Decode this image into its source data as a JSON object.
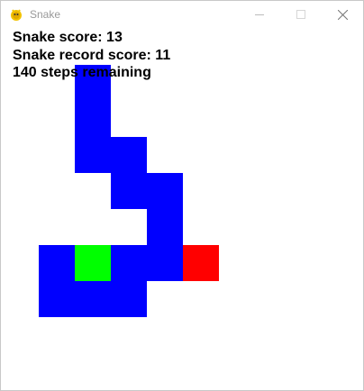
{
  "window": {
    "title": "Snake",
    "app_icon": "pygame-snake-icon"
  },
  "hud": {
    "score_text": "Snake score: 13",
    "record_text": "Snake record score: 11",
    "steps_text": "140 steps remaining"
  },
  "game": {
    "grid_columns": 10,
    "grid_rows": 10,
    "colors": {
      "snake_body": "#0000ff",
      "snake_head": "#00ff00",
      "food": "#ff0000",
      "background": "#ffffff"
    },
    "snake_head": [
      2,
      6
    ],
    "snake_body": [
      [
        2,
        1
      ],
      [
        2,
        2
      ],
      [
        2,
        3
      ],
      [
        3,
        3
      ],
      [
        3,
        4
      ],
      [
        4,
        4
      ],
      [
        4,
        5
      ],
      [
        4,
        6
      ],
      [
        3,
        6
      ],
      [
        1,
        6
      ],
      [
        1,
        7
      ],
      [
        2,
        7
      ],
      [
        3,
        7
      ]
    ],
    "food": [
      5,
      6
    ]
  }
}
